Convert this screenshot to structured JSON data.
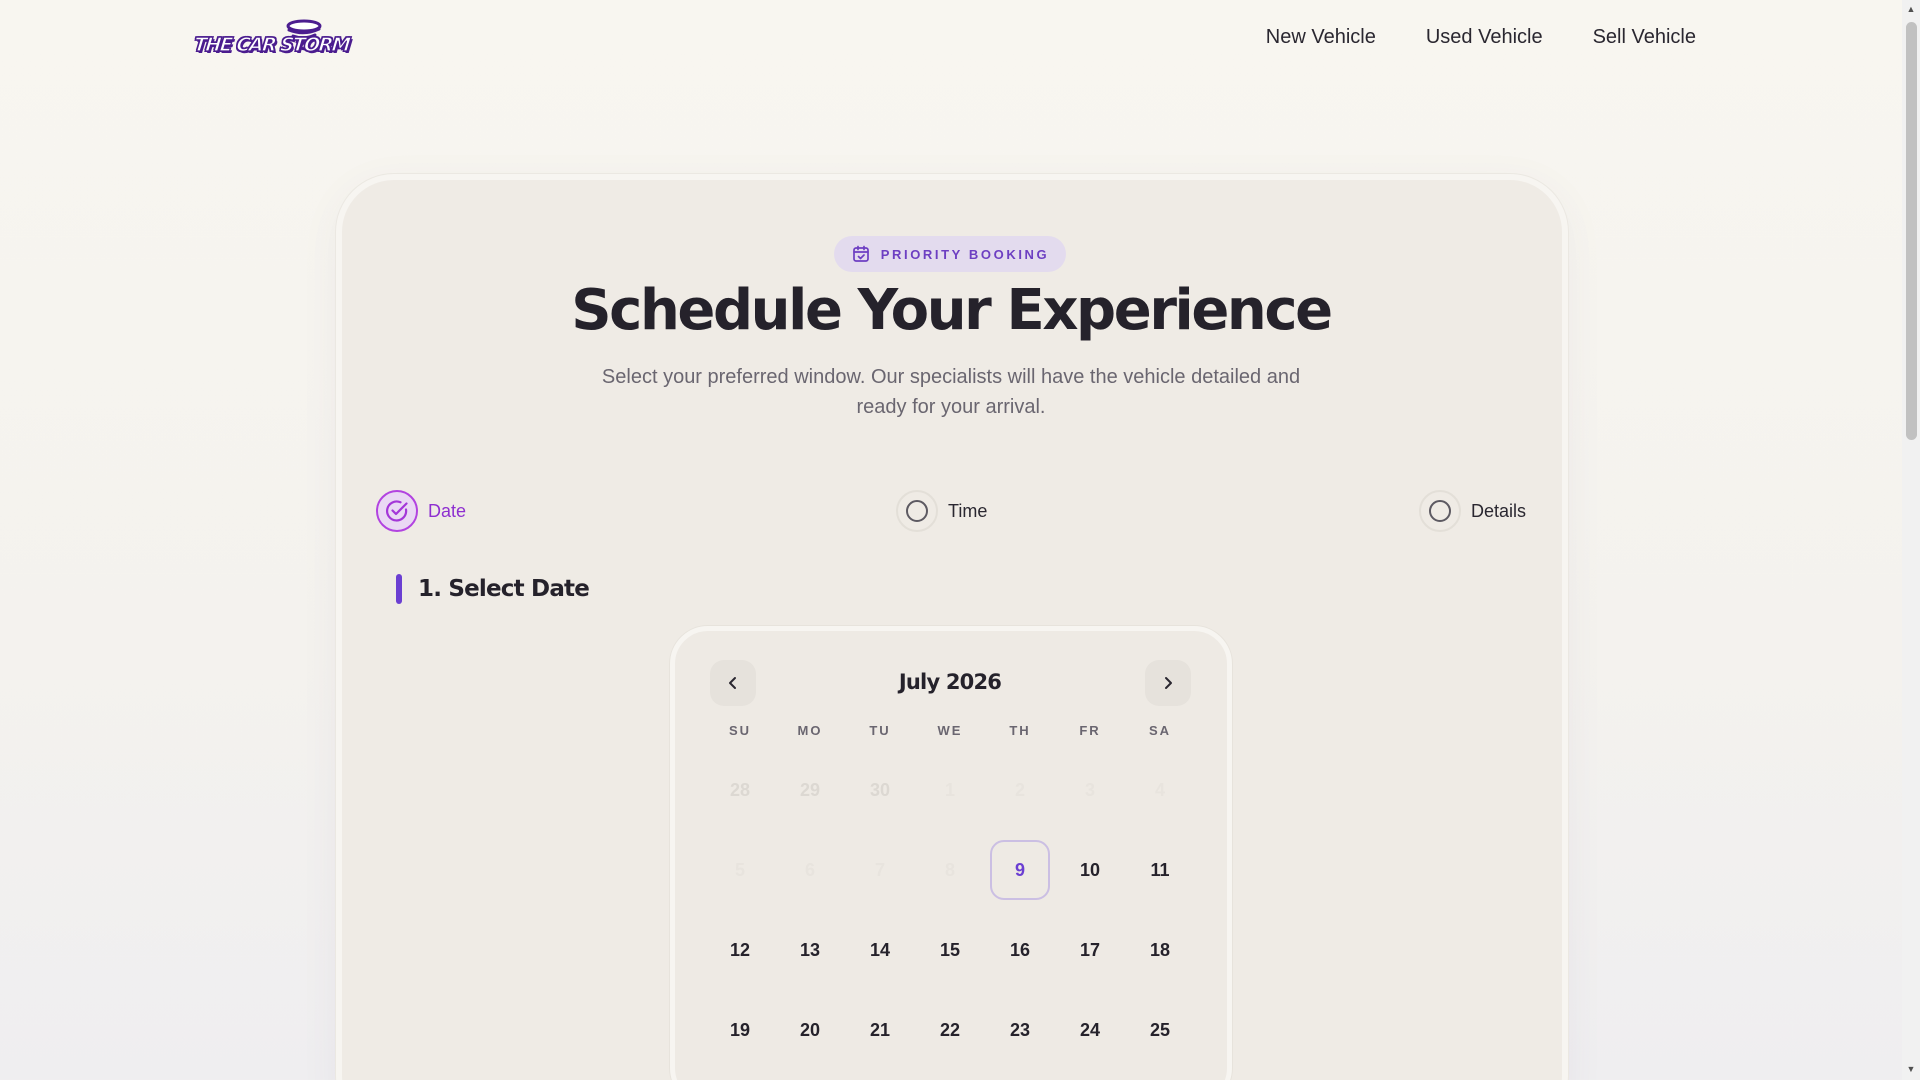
{
  "header": {
    "logo_text": "THE CAR STORM",
    "nav": [
      "New Vehicle",
      "Used Vehicle",
      "Sell Vehicle"
    ]
  },
  "booking": {
    "badge": "PRIORITY BOOKING",
    "title": "Schedule Your Experience",
    "subtitle": "Select your preferred window. Our specialists will have the vehicle detailed and ready for your arrival.",
    "steps": [
      {
        "label": "Date",
        "state": "active"
      },
      {
        "label": "Time",
        "state": "pending"
      },
      {
        "label": "Details",
        "state": "pending"
      }
    ],
    "section_title": "1. Select Date"
  },
  "calendar": {
    "month_label": "July 2026",
    "weekdays": [
      "SU",
      "MO",
      "TU",
      "WE",
      "TH",
      "FR",
      "SA"
    ],
    "selected_day": "9",
    "days": [
      {
        "d": "28",
        "s": "muted"
      },
      {
        "d": "29",
        "s": "muted"
      },
      {
        "d": "30",
        "s": "muted"
      },
      {
        "d": "1",
        "s": "faint"
      },
      {
        "d": "2",
        "s": "faint"
      },
      {
        "d": "3",
        "s": "faint"
      },
      {
        "d": "4",
        "s": "faint"
      },
      {
        "d": "5",
        "s": "faint"
      },
      {
        "d": "6",
        "s": "faint"
      },
      {
        "d": "7",
        "s": "faint"
      },
      {
        "d": "8",
        "s": "faint"
      },
      {
        "d": "9",
        "s": "today"
      },
      {
        "d": "10",
        "s": "active"
      },
      {
        "d": "11",
        "s": "active"
      },
      {
        "d": "12",
        "s": "active"
      },
      {
        "d": "13",
        "s": "active"
      },
      {
        "d": "14",
        "s": "active"
      },
      {
        "d": "15",
        "s": "active"
      },
      {
        "d": "16",
        "s": "active"
      },
      {
        "d": "17",
        "s": "active"
      },
      {
        "d": "18",
        "s": "active"
      },
      {
        "d": "19",
        "s": "active"
      },
      {
        "d": "20",
        "s": "active"
      },
      {
        "d": "21",
        "s": "active"
      },
      {
        "d": "22",
        "s": "active"
      },
      {
        "d": "23",
        "s": "active"
      },
      {
        "d": "24",
        "s": "active"
      },
      {
        "d": "25",
        "s": "active"
      }
    ]
  },
  "colors": {
    "accent": "#6b3fd2",
    "step_active": "#8e2fd0",
    "badge_bg": "#e3dbee",
    "card_bg": "#efebe5"
  },
  "icons": {
    "badge": "calendar-check-icon",
    "prev": "chevron-left-icon",
    "next": "chevron-right-icon",
    "step_done": "check-circle-icon"
  }
}
